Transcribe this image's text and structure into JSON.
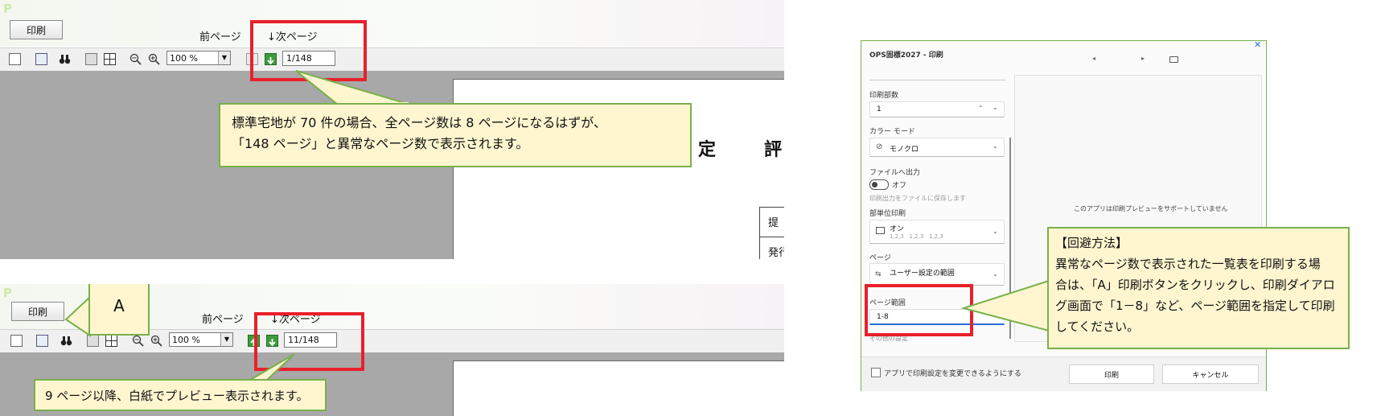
{
  "top_panel": {
    "logo": "P",
    "print_button": "印刷",
    "prev_page": "前ページ",
    "next_page": "↓次ページ",
    "zoom": "100 %",
    "page_counter": "1/148",
    "sheet_title_chars": [
      "定",
      "評"
    ],
    "table_cells": [
      "提",
      "発行"
    ],
    "callout": {
      "line1": "標準宅地が 70 件の場合、全ページ数は 8 ページになるはずが、",
      "line2": "「148 ページ」と異常なページ数で表示されます。"
    }
  },
  "bottom_panel": {
    "logo": "P",
    "print_button": "印刷",
    "prev_page": "前ページ",
    "next_page": "↓次ページ",
    "zoom": "100 %",
    "page_counter": "11/148",
    "label_a": "A",
    "callout": "9 ページ以降、白紙でプレビュー表示されます。"
  },
  "print_dialog": {
    "title": "OPS固標2027 - 印刷",
    "copies_label": "印刷部数",
    "copies_value": "1",
    "color_mode_label": "カラー モード",
    "color_mode_value": "モノクロ",
    "file_output_label": "ファイルへ出力",
    "file_output_toggle": "オフ",
    "file_output_desc": "印刷出力をファイルに保存します",
    "collate_label": "部単位印刷",
    "collate_value": "オン",
    "collate_sub": "1,2,3   1,2,3   1,2,3",
    "pages_label": "ページ",
    "pages_value": "ユーザー設定の範囲",
    "page_range_label": "ページ範囲",
    "page_range_value": "1-8",
    "other_settings": "その他の設定",
    "no_preview": "このアプリは印刷プレビューをサポートしていません",
    "allow_change": "アプリで印刷設定を変更できるようにする",
    "print_button": "印刷",
    "cancel_button": "キャンセル"
  },
  "workaround_callout": {
    "heading": "【回避方法】",
    "lines": [
      "異常なページ数で表示された一覧表を印刷する場",
      "合は、「A」印刷ボタンをクリックし、印刷ダイアロ",
      "グ画面で「1－8」など、ページ範囲を指定して印刷",
      "してください。"
    ]
  },
  "colors": {
    "highlight_red": "#e8202a",
    "callout_fill": "#fff6d0",
    "callout_border": "#79b04a",
    "preview_gray": "#a8a8a8"
  }
}
